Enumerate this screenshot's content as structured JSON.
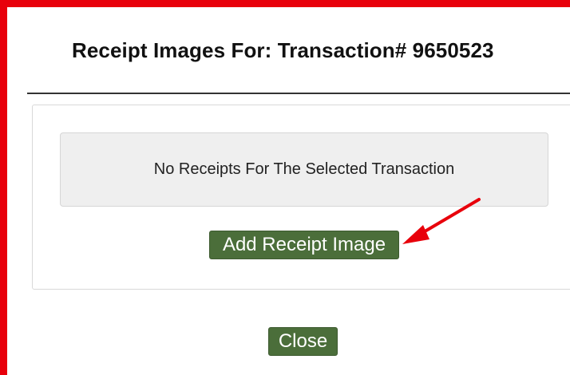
{
  "modal": {
    "title": "Receipt Images For: Transaction# 9650523",
    "empty_message": "No Receipts For The Selected Transaction",
    "add_button_label": "Add Receipt Image",
    "close_button_label": "Close"
  },
  "colors": {
    "highlight_border": "#e8000b",
    "button_bg": "#4b6e3a",
    "message_bg": "#efefef",
    "annotation_arrow": "#e8000b"
  },
  "icons": {
    "annotation": "red-arrow-icon"
  }
}
